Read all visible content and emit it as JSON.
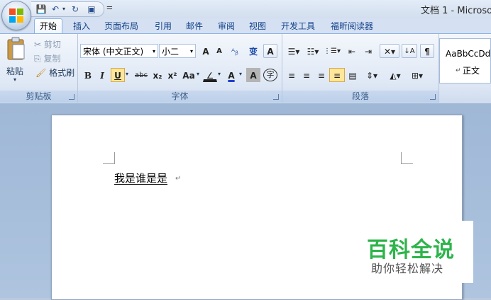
{
  "window": {
    "title": "文档 1 - Microsof"
  },
  "quick_access": {
    "save": "💾",
    "undo": "↶",
    "redo": "↻",
    "print_preview": "▣",
    "customize": "⚌"
  },
  "tabs": [
    "开始",
    "插入",
    "页面布局",
    "引用",
    "邮件",
    "审阅",
    "视图",
    "开发工具",
    "福昕阅读器"
  ],
  "active_tab": "开始",
  "clipboard": {
    "label": "剪贴板",
    "paste": "粘贴",
    "cut": "剪切",
    "copy": "复制",
    "format_painter": "格式刷"
  },
  "font": {
    "label": "字体",
    "name": "宋体 (中文正文)",
    "size": "小二",
    "grow": "A",
    "shrink": "A",
    "clear": "ᴬᵦ",
    "pinyin": "变",
    "border": "A",
    "bold": "B",
    "italic": "I",
    "underline": "U",
    "strike": "abc",
    "subscript": "x₂",
    "superscript": "x²",
    "case": "Aa",
    "highlight": "∠",
    "color": "A",
    "shading": "A",
    "enclose": "字"
  },
  "paragraph": {
    "label": "段落"
  },
  "styles": {
    "preview": "AaBbCcDdI",
    "name": "正文"
  },
  "document": {
    "text": "我是谁是是"
  },
  "watermark": {
    "title": "百科全说",
    "subtitle": "助你轻松解决"
  },
  "colors": {
    "accent": "#2db44a",
    "ribbon": "#dfe8f5",
    "highlight": "#ffe69a"
  }
}
